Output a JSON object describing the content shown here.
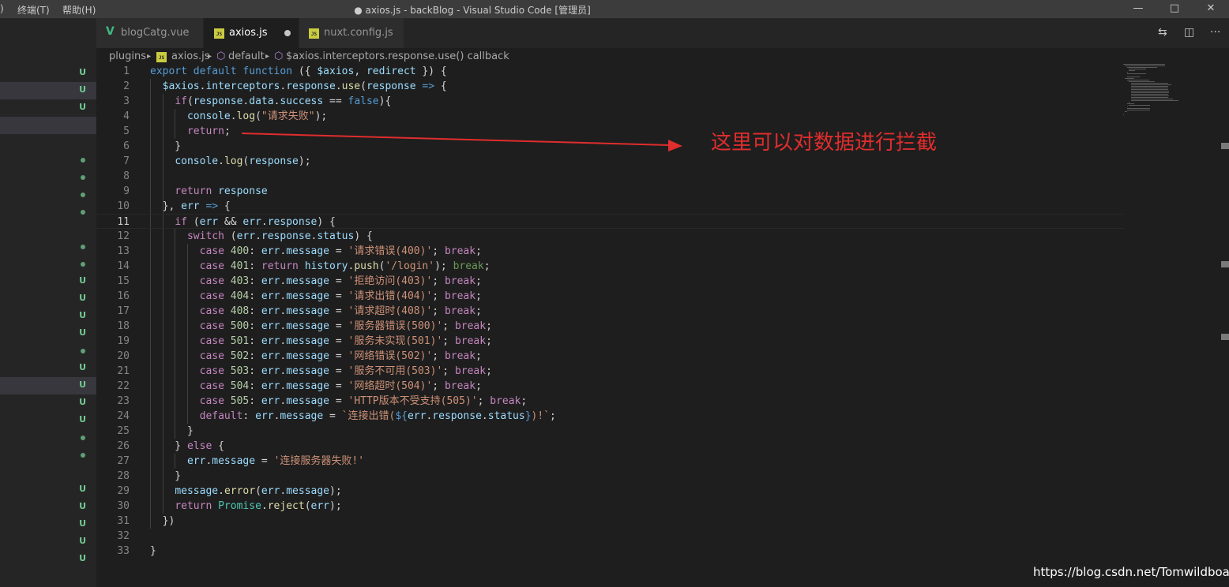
{
  "window": {
    "title": "● axios.js - backBlog - Visual Studio Code [管理员]",
    "menu": [
      ")",
      "终端(T)",
      "帮助(H)"
    ],
    "controls": {
      "minimize": "—",
      "maximize": "□",
      "close": "✕"
    }
  },
  "tabs": [
    {
      "label": "blogCatg.vue",
      "icon": "vue-icon",
      "active": false
    },
    {
      "label": "axios.js",
      "icon": "js-icon",
      "active": true,
      "dirty": true
    },
    {
      "label": "nuxt.config.js",
      "icon": "js-icon",
      "active": false
    }
  ],
  "file_icon_text": "JS",
  "vue_icon_text": "V",
  "editor_actions": {
    "compare": "⇆",
    "split": "◫",
    "more": "···"
  },
  "breadcrumb": {
    "items": [
      "plugins",
      "axios.js",
      "default",
      "$axios.interceptors.response.use() callback"
    ],
    "separator": "▸"
  },
  "explorer_markers": {
    "u": "U",
    "rows": [
      {
        "kind": "u"
      },
      {
        "kind": "u"
      },
      {
        "kind": "u"
      },
      {
        "kind": "dot"
      },
      {
        "kind": "dot"
      },
      {
        "kind": "dot"
      },
      {
        "kind": "dot"
      },
      {
        "kind": "dot"
      },
      {
        "kind": "dot"
      },
      {
        "kind": "u"
      },
      {
        "kind": "u"
      },
      {
        "kind": "u"
      },
      {
        "kind": "u"
      },
      {
        "kind": "dot"
      },
      {
        "kind": "u"
      },
      {
        "kind": "u"
      },
      {
        "kind": "u"
      },
      {
        "kind": "u"
      },
      {
        "kind": "dot"
      },
      {
        "kind": "dot"
      },
      {
        "kind": "u"
      },
      {
        "kind": "u"
      },
      {
        "kind": "u"
      },
      {
        "kind": "u"
      },
      {
        "kind": "u"
      }
    ]
  },
  "code": {
    "current_line": 11,
    "lines": [
      [
        [
          "k",
          "export"
        ],
        [
          "p",
          " "
        ],
        [
          "k",
          "default"
        ],
        [
          "p",
          " "
        ],
        [
          "k",
          "function"
        ],
        [
          "p",
          " ({ "
        ],
        [
          "v",
          "$axios"
        ],
        [
          "p",
          ", "
        ],
        [
          "v",
          "redirect"
        ],
        [
          "p",
          " }) {"
        ]
      ],
      [
        [
          "p",
          "  "
        ],
        [
          "v",
          "$axios"
        ],
        [
          "p",
          "."
        ],
        [
          "v",
          "interceptors"
        ],
        [
          "p",
          "."
        ],
        [
          "v",
          "response"
        ],
        [
          "p",
          "."
        ],
        [
          "f",
          "use"
        ],
        [
          "p",
          "("
        ],
        [
          "v",
          "response"
        ],
        [
          "p",
          " "
        ],
        [
          "k",
          "=>"
        ],
        [
          "p",
          " {"
        ]
      ],
      [
        [
          "p",
          "    "
        ],
        [
          "c",
          "if"
        ],
        [
          "p",
          "("
        ],
        [
          "v",
          "response"
        ],
        [
          "p",
          "."
        ],
        [
          "v",
          "data"
        ],
        [
          "p",
          "."
        ],
        [
          "v",
          "success"
        ],
        [
          "p",
          " == "
        ],
        [
          "k",
          "false"
        ],
        [
          "p",
          "){"
        ]
      ],
      [
        [
          "p",
          "      "
        ],
        [
          "v",
          "console"
        ],
        [
          "p",
          "."
        ],
        [
          "f",
          "log"
        ],
        [
          "p",
          "("
        ],
        [
          "s",
          "\"请求失败\""
        ],
        [
          "p",
          ");"
        ]
      ],
      [
        [
          "p",
          "      "
        ],
        [
          "c",
          "return"
        ],
        [
          "p",
          ";"
        ]
      ],
      [
        [
          "p",
          "    }"
        ]
      ],
      [
        [
          "p",
          "    "
        ],
        [
          "v",
          "console"
        ],
        [
          "p",
          "."
        ],
        [
          "f",
          "log"
        ],
        [
          "p",
          "("
        ],
        [
          "v",
          "response"
        ],
        [
          "p",
          ");"
        ]
      ],
      [
        [
          "p",
          ""
        ]
      ],
      [
        [
          "p",
          "    "
        ],
        [
          "c",
          "return"
        ],
        [
          "p",
          " "
        ],
        [
          "v",
          "response"
        ]
      ],
      [
        [
          "p",
          "  }, "
        ],
        [
          "v",
          "err"
        ],
        [
          "p",
          " "
        ],
        [
          "k",
          "=>"
        ],
        [
          "p",
          " {"
        ]
      ],
      [
        [
          "p",
          "    "
        ],
        [
          "c",
          "if"
        ],
        [
          "p",
          " ("
        ],
        [
          "v",
          "err"
        ],
        [
          "p",
          " && "
        ],
        [
          "v",
          "err"
        ],
        [
          "p",
          "."
        ],
        [
          "v",
          "response"
        ],
        [
          "p",
          ") {"
        ]
      ],
      [
        [
          "p",
          "      "
        ],
        [
          "c",
          "switch"
        ],
        [
          "p",
          " ("
        ],
        [
          "v",
          "err"
        ],
        [
          "p",
          "."
        ],
        [
          "v",
          "response"
        ],
        [
          "p",
          "."
        ],
        [
          "v",
          "status"
        ],
        [
          "p",
          ") {"
        ]
      ],
      [
        [
          "p",
          "        "
        ],
        [
          "c",
          "case"
        ],
        [
          "p",
          " "
        ],
        [
          "n",
          "400"
        ],
        [
          "p",
          ": "
        ],
        [
          "v",
          "err"
        ],
        [
          "p",
          "."
        ],
        [
          "v",
          "message"
        ],
        [
          "p",
          " = "
        ],
        [
          "s",
          "'请求错误(400)'"
        ],
        [
          "p",
          "; "
        ],
        [
          "c",
          "break"
        ],
        [
          "p",
          ";"
        ]
      ],
      [
        [
          "p",
          "        "
        ],
        [
          "c",
          "case"
        ],
        [
          "p",
          " "
        ],
        [
          "n",
          "401"
        ],
        [
          "p",
          ": "
        ],
        [
          "c",
          "return"
        ],
        [
          "p",
          " "
        ],
        [
          "v",
          "history"
        ],
        [
          "p",
          "."
        ],
        [
          "f",
          "push"
        ],
        [
          "p",
          "("
        ],
        [
          "s",
          "'/login'"
        ],
        [
          "p",
          "); "
        ],
        [
          "g",
          "break"
        ],
        [
          "p",
          ";"
        ]
      ],
      [
        [
          "p",
          "        "
        ],
        [
          "c",
          "case"
        ],
        [
          "p",
          " "
        ],
        [
          "n",
          "403"
        ],
        [
          "p",
          ": "
        ],
        [
          "v",
          "err"
        ],
        [
          "p",
          "."
        ],
        [
          "v",
          "message"
        ],
        [
          "p",
          " = "
        ],
        [
          "s",
          "'拒绝访问(403)'"
        ],
        [
          "p",
          "; "
        ],
        [
          "c",
          "break"
        ],
        [
          "p",
          ";"
        ]
      ],
      [
        [
          "p",
          "        "
        ],
        [
          "c",
          "case"
        ],
        [
          "p",
          " "
        ],
        [
          "n",
          "404"
        ],
        [
          "p",
          ": "
        ],
        [
          "v",
          "err"
        ],
        [
          "p",
          "."
        ],
        [
          "v",
          "message"
        ],
        [
          "p",
          " = "
        ],
        [
          "s",
          "'请求出错(404)'"
        ],
        [
          "p",
          "; "
        ],
        [
          "c",
          "break"
        ],
        [
          "p",
          ";"
        ]
      ],
      [
        [
          "p",
          "        "
        ],
        [
          "c",
          "case"
        ],
        [
          "p",
          " "
        ],
        [
          "n",
          "408"
        ],
        [
          "p",
          ": "
        ],
        [
          "v",
          "err"
        ],
        [
          "p",
          "."
        ],
        [
          "v",
          "message"
        ],
        [
          "p",
          " = "
        ],
        [
          "s",
          "'请求超时(408)'"
        ],
        [
          "p",
          "; "
        ],
        [
          "c",
          "break"
        ],
        [
          "p",
          ";"
        ]
      ],
      [
        [
          "p",
          "        "
        ],
        [
          "c",
          "case"
        ],
        [
          "p",
          " "
        ],
        [
          "n",
          "500"
        ],
        [
          "p",
          ": "
        ],
        [
          "v",
          "err"
        ],
        [
          "p",
          "."
        ],
        [
          "v",
          "message"
        ],
        [
          "p",
          " = "
        ],
        [
          "s",
          "'服务器错误(500)'"
        ],
        [
          "p",
          "; "
        ],
        [
          "c",
          "break"
        ],
        [
          "p",
          ";"
        ]
      ],
      [
        [
          "p",
          "        "
        ],
        [
          "c",
          "case"
        ],
        [
          "p",
          " "
        ],
        [
          "n",
          "501"
        ],
        [
          "p",
          ": "
        ],
        [
          "v",
          "err"
        ],
        [
          "p",
          "."
        ],
        [
          "v",
          "message"
        ],
        [
          "p",
          " = "
        ],
        [
          "s",
          "'服务未实现(501)'"
        ],
        [
          "p",
          "; "
        ],
        [
          "c",
          "break"
        ],
        [
          "p",
          ";"
        ]
      ],
      [
        [
          "p",
          "        "
        ],
        [
          "c",
          "case"
        ],
        [
          "p",
          " "
        ],
        [
          "n",
          "502"
        ],
        [
          "p",
          ": "
        ],
        [
          "v",
          "err"
        ],
        [
          "p",
          "."
        ],
        [
          "v",
          "message"
        ],
        [
          "p",
          " = "
        ],
        [
          "s",
          "'网络错误(502)'"
        ],
        [
          "p",
          "; "
        ],
        [
          "c",
          "break"
        ],
        [
          "p",
          ";"
        ]
      ],
      [
        [
          "p",
          "        "
        ],
        [
          "c",
          "case"
        ],
        [
          "p",
          " "
        ],
        [
          "n",
          "503"
        ],
        [
          "p",
          ": "
        ],
        [
          "v",
          "err"
        ],
        [
          "p",
          "."
        ],
        [
          "v",
          "message"
        ],
        [
          "p",
          " = "
        ],
        [
          "s",
          "'服务不可用(503)'"
        ],
        [
          "p",
          "; "
        ],
        [
          "c",
          "break"
        ],
        [
          "p",
          ";"
        ]
      ],
      [
        [
          "p",
          "        "
        ],
        [
          "c",
          "case"
        ],
        [
          "p",
          " "
        ],
        [
          "n",
          "504"
        ],
        [
          "p",
          ": "
        ],
        [
          "v",
          "err"
        ],
        [
          "p",
          "."
        ],
        [
          "v",
          "message"
        ],
        [
          "p",
          " = "
        ],
        [
          "s",
          "'网络超时(504)'"
        ],
        [
          "p",
          "; "
        ],
        [
          "c",
          "break"
        ],
        [
          "p",
          ";"
        ]
      ],
      [
        [
          "p",
          "        "
        ],
        [
          "c",
          "case"
        ],
        [
          "p",
          " "
        ],
        [
          "n",
          "505"
        ],
        [
          "p",
          ": "
        ],
        [
          "v",
          "err"
        ],
        [
          "p",
          "."
        ],
        [
          "v",
          "message"
        ],
        [
          "p",
          " = "
        ],
        [
          "s",
          "'HTTP版本不受支持(505)'"
        ],
        [
          "p",
          "; "
        ],
        [
          "c",
          "break"
        ],
        [
          "p",
          ";"
        ]
      ],
      [
        [
          "p",
          "        "
        ],
        [
          "c",
          "default"
        ],
        [
          "p",
          ": "
        ],
        [
          "v",
          "err"
        ],
        [
          "p",
          "."
        ],
        [
          "v",
          "message"
        ],
        [
          "p",
          " = "
        ],
        [
          "s",
          "`连接出错("
        ],
        [
          "k",
          "${"
        ],
        [
          "v",
          "err"
        ],
        [
          "p",
          "."
        ],
        [
          "v",
          "response"
        ],
        [
          "p",
          "."
        ],
        [
          "v",
          "status"
        ],
        [
          "k",
          "}"
        ],
        [
          "s",
          ")!`"
        ],
        [
          "p",
          ";"
        ]
      ],
      [
        [
          "p",
          "      }"
        ]
      ],
      [
        [
          "p",
          "    } "
        ],
        [
          "c",
          "else"
        ],
        [
          "p",
          " {"
        ]
      ],
      [
        [
          "p",
          "      "
        ],
        [
          "v",
          "err"
        ],
        [
          "p",
          "."
        ],
        [
          "v",
          "message"
        ],
        [
          "p",
          " = "
        ],
        [
          "s",
          "'连接服务器失败!'"
        ]
      ],
      [
        [
          "p",
          "    }"
        ]
      ],
      [
        [
          "p",
          "    "
        ],
        [
          "v",
          "message"
        ],
        [
          "p",
          "."
        ],
        [
          "f",
          "error"
        ],
        [
          "p",
          "("
        ],
        [
          "v",
          "err"
        ],
        [
          "p",
          "."
        ],
        [
          "v",
          "message"
        ],
        [
          "p",
          ");"
        ]
      ],
      [
        [
          "p",
          "    "
        ],
        [
          "c",
          "return"
        ],
        [
          "p",
          " "
        ],
        [
          "t",
          "Promise"
        ],
        [
          "p",
          "."
        ],
        [
          "f",
          "reject"
        ],
        [
          "p",
          "("
        ],
        [
          "v",
          "err"
        ],
        [
          "p",
          ");"
        ]
      ],
      [
        [
          "p",
          "  })"
        ]
      ],
      [
        [
          "p",
          ""
        ]
      ],
      [
        [
          "p",
          "}"
        ]
      ]
    ]
  },
  "annotation": {
    "text": "这里可以对数据进行拦截",
    "color": "#e02d2d"
  },
  "watermark": "https://blog.csdn.net/Tomwildboar"
}
